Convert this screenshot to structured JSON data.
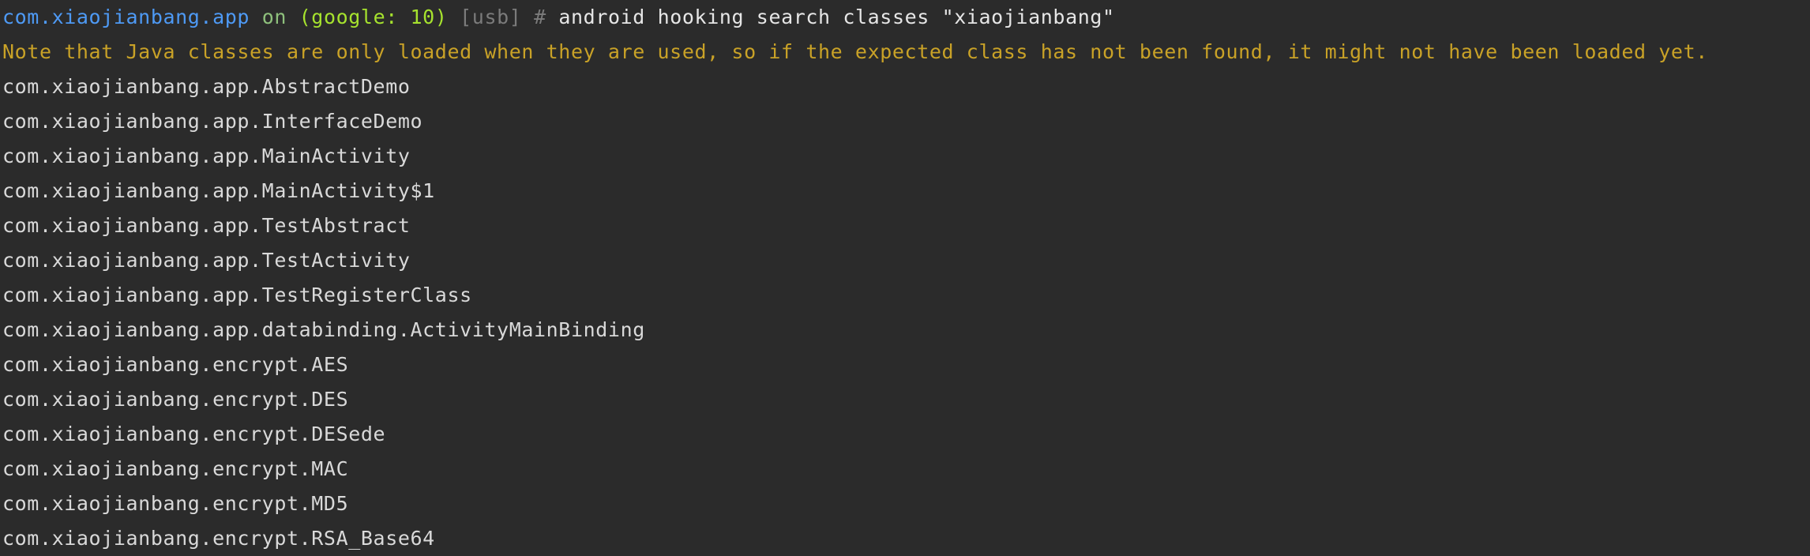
{
  "prompt": {
    "package": "com.xiaojianbang.app",
    "on": "on",
    "device": "(google: 10)",
    "transport": "[usb]",
    "hash": "#",
    "command": "android hooking search classes \"xiaojianbang\""
  },
  "note": "Note that Java classes are only loaded when they are used, so if the expected class has not been found, it might not have been loaded yet.",
  "results": [
    "com.xiaojianbang.app.AbstractDemo",
    "com.xiaojianbang.app.InterfaceDemo",
    "com.xiaojianbang.app.MainActivity",
    "com.xiaojianbang.app.MainActivity$1",
    "com.xiaojianbang.app.TestAbstract",
    "com.xiaojianbang.app.TestActivity",
    "com.xiaojianbang.app.TestRegisterClass",
    "com.xiaojianbang.app.databinding.ActivityMainBinding",
    "com.xiaojianbang.encrypt.AES",
    "com.xiaojianbang.encrypt.DES",
    "com.xiaojianbang.encrypt.DESede",
    "com.xiaojianbang.encrypt.MAC",
    "com.xiaojianbang.encrypt.MD5",
    "com.xiaojianbang.encrypt.RSA_Base64"
  ],
  "colors": {
    "background": "#2b2b2b",
    "package": "#4e9af5",
    "on": "#8ec07c",
    "device": "#a6e22e",
    "muted": "#7b7b7b",
    "note": "#c9a227",
    "text": "#d9d9d9"
  }
}
